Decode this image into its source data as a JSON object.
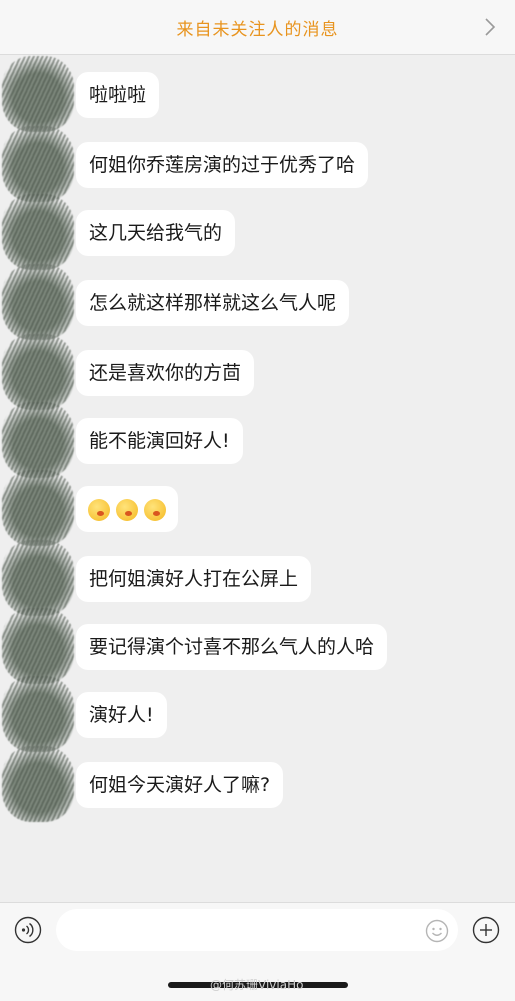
{
  "header": {
    "title": "来自未关注人的消息"
  },
  "messages": [
    {
      "text": "啦啦啦"
    },
    {
      "text": "何姐你乔莲房演的过于优秀了哈"
    },
    {
      "text": "这几天给我气的"
    },
    {
      "text": "怎么就这样那样就这么气人呢"
    },
    {
      "text": "还是喜欢你的方茴"
    },
    {
      "text": "能不能演回好人!"
    },
    {
      "emoji_count": 3,
      "emoji_name": "pleading-face-emoji"
    },
    {
      "text": "把何姐演好人打在公屏上"
    },
    {
      "text": "要记得演个讨喜不那么气人的人哈"
    },
    {
      "text": "演好人!"
    },
    {
      "text": "何姐今天演好人了嘛?"
    }
  ],
  "input": {
    "placeholder": "",
    "value": ""
  },
  "watermark": "@何苏珊ViviaHo",
  "icons": {
    "voice": "voice-icon",
    "emoji": "smile-icon",
    "plus": "plus-icon",
    "chevron": "chevron-right-icon"
  },
  "colors": {
    "header_title": "#e8941f",
    "background": "#efefef",
    "bubble": "#ffffff"
  }
}
